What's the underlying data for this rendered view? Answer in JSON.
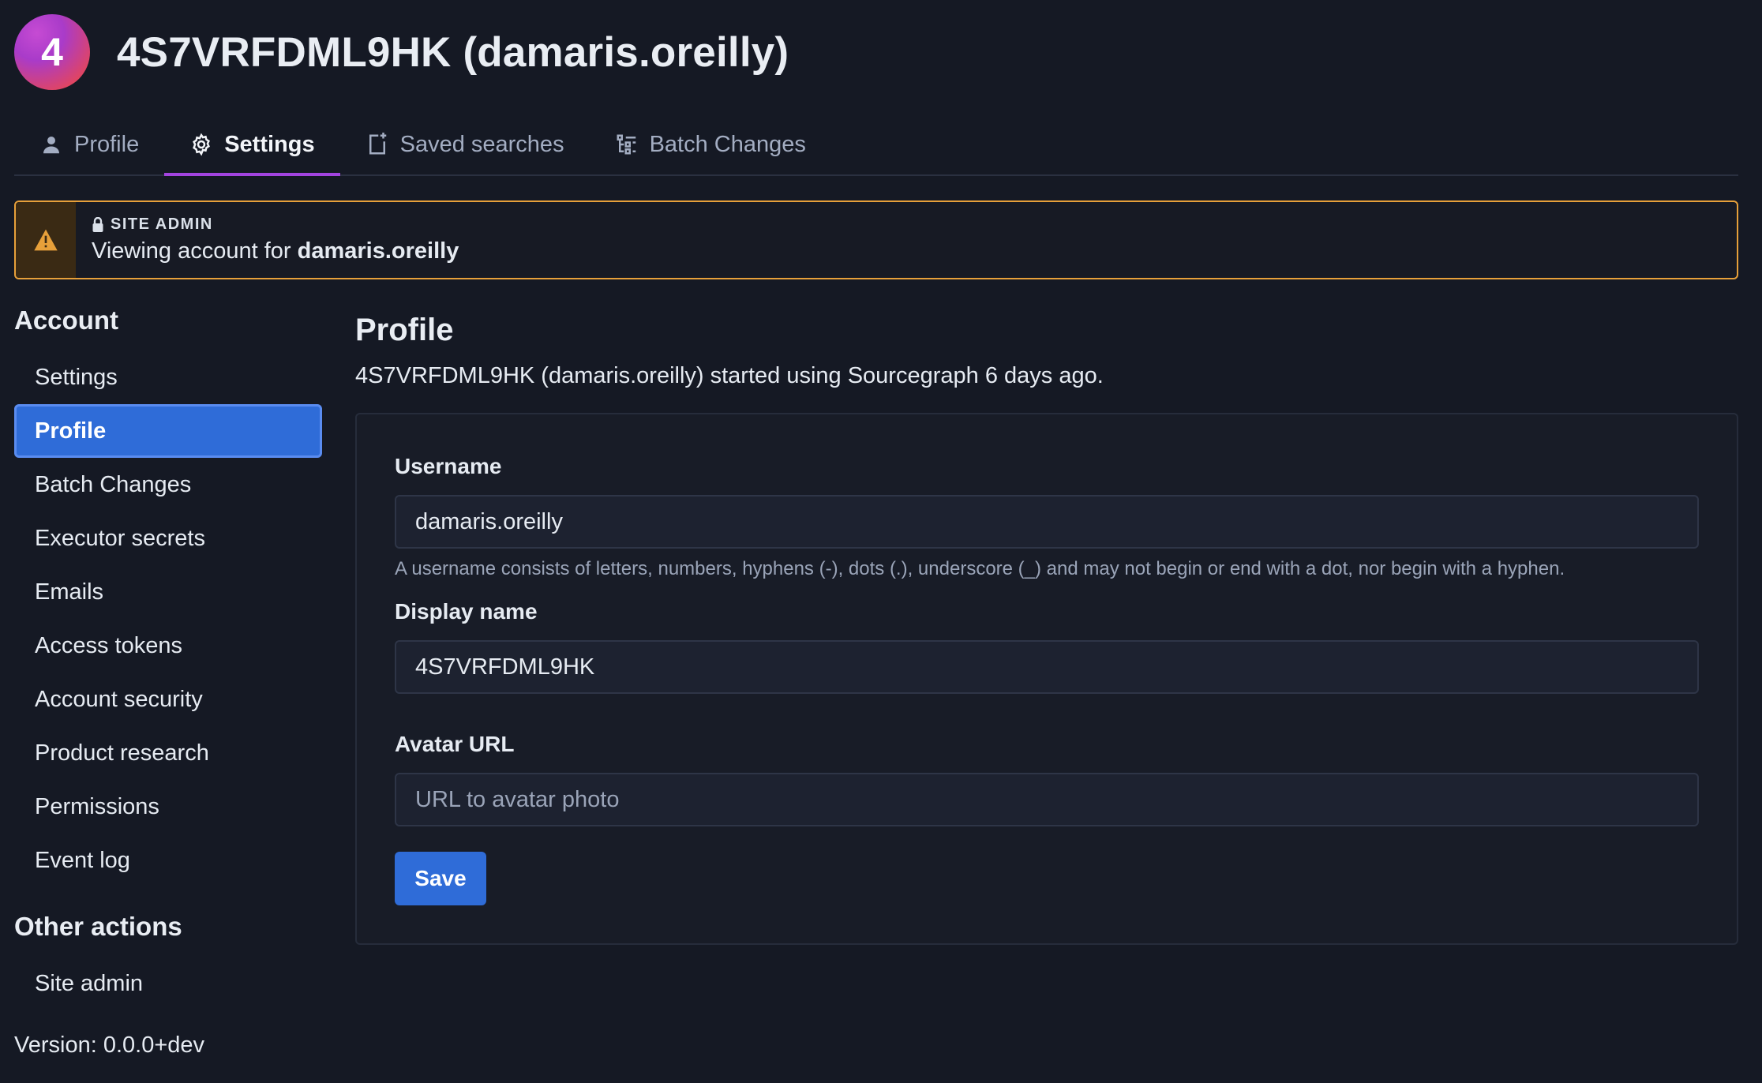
{
  "header": {
    "avatar_initial": "4",
    "title": "4S7VRFDML9HK (damaris.oreilly)"
  },
  "tabs": [
    {
      "label": "Profile",
      "icon": "user-icon",
      "active": false
    },
    {
      "label": "Settings",
      "icon": "gear-icon",
      "active": true
    },
    {
      "label": "Saved searches",
      "icon": "saved-search-icon",
      "active": false
    },
    {
      "label": "Batch Changes",
      "icon": "batch-changes-icon",
      "active": false
    }
  ],
  "alert": {
    "kicker": "SITE ADMIN",
    "text_prefix": "Viewing account for ",
    "username": "damaris.oreilly",
    "color": "#e7a03a"
  },
  "sidebar": {
    "account_heading": "Account",
    "items": [
      {
        "label": "Settings"
      },
      {
        "label": "Profile",
        "active": true
      },
      {
        "label": "Batch Changes"
      },
      {
        "label": "Executor secrets"
      },
      {
        "label": "Emails"
      },
      {
        "label": "Access tokens"
      },
      {
        "label": "Account security"
      },
      {
        "label": "Product research"
      },
      {
        "label": "Permissions"
      },
      {
        "label": "Event log"
      }
    ],
    "other_heading": "Other actions",
    "other_items": [
      {
        "label": "Site admin"
      }
    ],
    "version": "Version: 0.0.0+dev"
  },
  "main": {
    "title": "Profile",
    "subtitle": "4S7VRFDML9HK (damaris.oreilly) started using Sourcegraph 6 days ago.",
    "form": {
      "username_label": "Username",
      "username_value": "damaris.oreilly",
      "username_help": "A username consists of letters, numbers, hyphens (-), dots (.), underscore (_) and may not begin or end with a dot, nor begin with a hyphen.",
      "display_name_label": "Display name",
      "display_name_value": "4S7VRFDML9HK",
      "avatar_url_label": "Avatar URL",
      "avatar_url_placeholder": "URL to avatar photo",
      "save_label": "Save"
    }
  },
  "colors": {
    "accent": "#2f6cd8",
    "tab_underline": "#a344e0",
    "warning": "#e7a03a"
  }
}
